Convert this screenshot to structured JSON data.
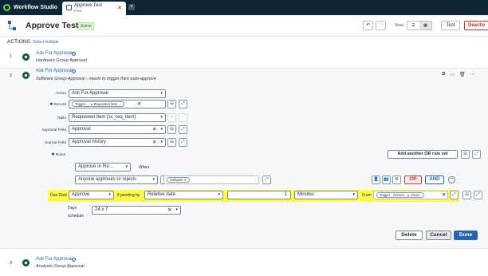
{
  "app": {
    "name": "Workflow Studio",
    "tab_title": "Approve Test",
    "tab_subtitle": "Flow"
  },
  "header": {
    "title": "Approve Test",
    "status": "Active",
    "view_label": "View:",
    "test_label": "Test",
    "deactivate_label": "Deactiv"
  },
  "actions": {
    "title": "ACTIONS",
    "select_multiple": "Select multiple",
    "items": [
      {
        "number": "1",
        "title": "Ask For Approval",
        "subtitle": "Hardware Group Approval"
      },
      {
        "number": "2",
        "title": "Ask For Approval",
        "subtitle": "Software Group Approval - needs to trigger then auto-approve"
      },
      {
        "number": "3",
        "title": "Ask For Approval",
        "subtitle": "Analysts  Group Approval"
      }
    ]
  },
  "form": {
    "action_label": "Action",
    "action_value": "Ask For Approval",
    "record_label": "Record",
    "record_pill_1": "Trigger -...",
    "record_pill_2": "Requested Item ...",
    "table_label": "Table",
    "table_value": "Requested Item [sc_req_item]",
    "approval_field_label": "Approval Field",
    "approval_field_value": "Approval",
    "journal_field_label": "Journal Field",
    "journal_field_value": "Approval history",
    "rules_label": "Rules",
    "add_or_rule_label": "Add another OR rule set",
    "rule_action_value": "Approve or Re...",
    "when_label": "When",
    "condition_value": "Anyone approves or rejects",
    "group_pill": "Software",
    "or_label": "OR",
    "and_label": "AND",
    "due_date_label": "Due Date",
    "due_action_value": "Approve",
    "if_pending_label": "if pending by",
    "relative_date_value": "Relative date",
    "duration_value": "1",
    "duration_unit": "Minutes",
    "from_label": "From",
    "from_pill_1": "Trigger - Service...",
    "from_pill_2": "Creat...",
    "days_label": "Days",
    "schedule_label": "schedule",
    "schedule_value": "24 x 7",
    "delete_label": "Delete",
    "cancel_label": "Cancel",
    "done_label": "Done"
  },
  "colors": {
    "topbar": "#0d2535",
    "link": "#2566b4",
    "highlight": "#fff93a",
    "deactivate": "#c0311e",
    "done": "#2566b4",
    "or": "#b8443a"
  }
}
